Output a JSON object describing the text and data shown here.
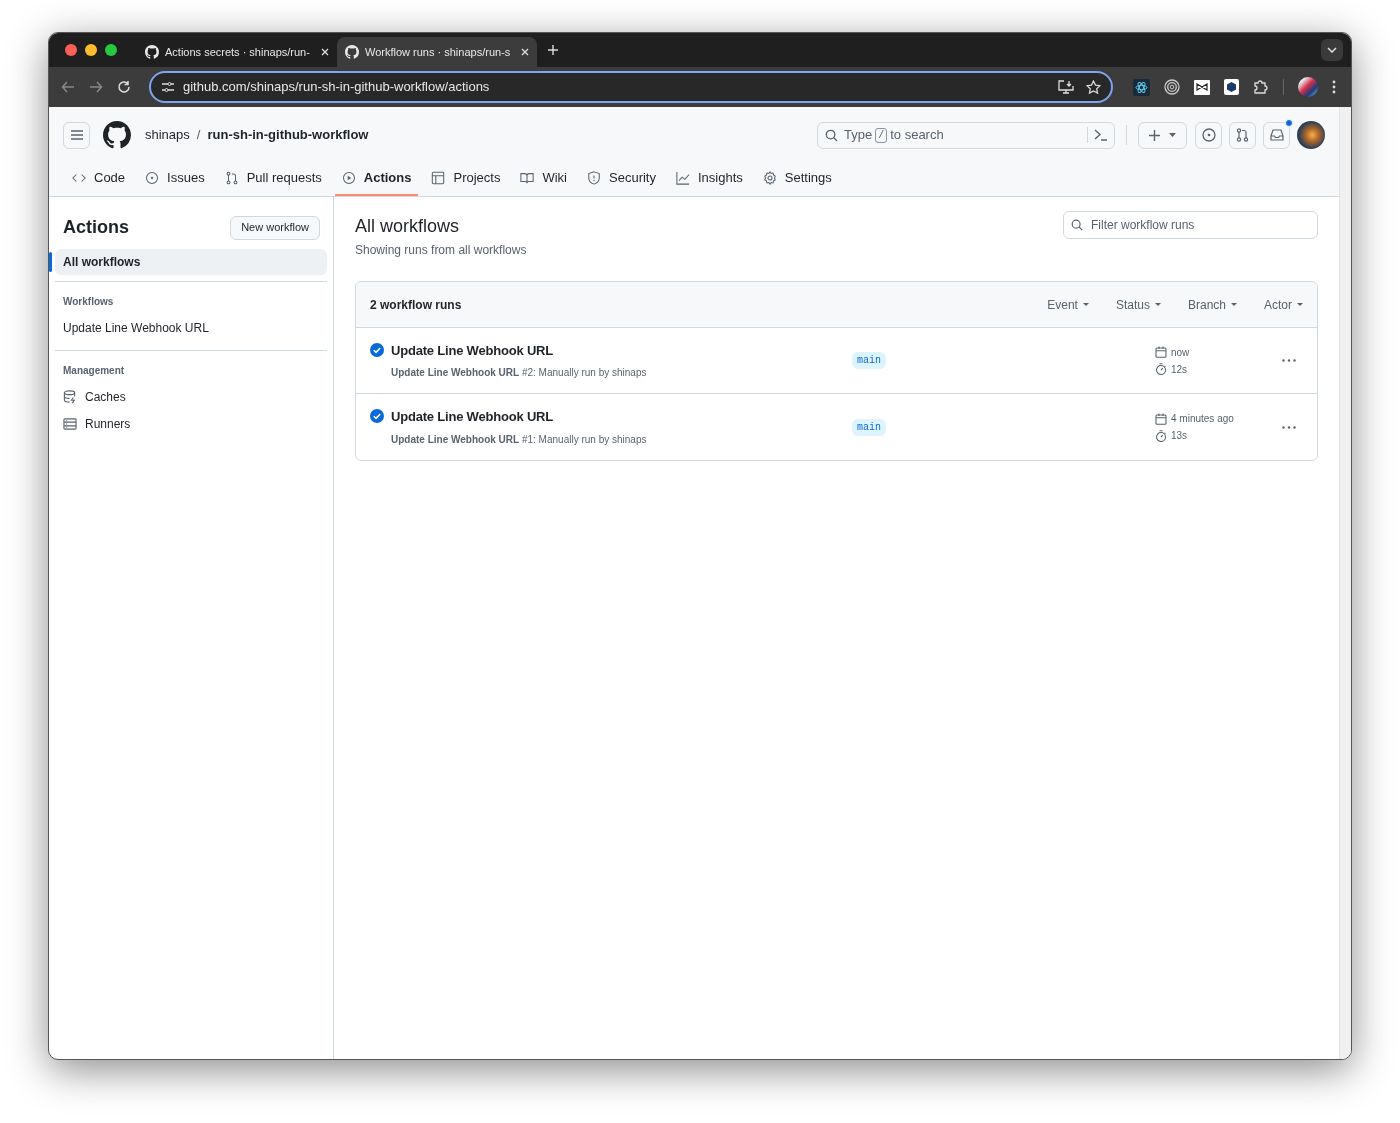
{
  "browser": {
    "tabs": [
      {
        "title": "Actions secrets · shinaps/run-",
        "selected": false
      },
      {
        "title": "Workflow runs · shinaps/run-s",
        "selected": true
      }
    ],
    "url": "github.com/shinaps/run-sh-in-github-workflow/actions"
  },
  "header": {
    "owner": "shinaps",
    "separator": "/",
    "repo": "run-sh-in-github-workflow",
    "search": {
      "placeholder": "Type",
      "shortcut_key": "/",
      "placeholder_end": "to search"
    },
    "notification_unread": true
  },
  "repo_tabs": [
    {
      "label": "Code",
      "selected": false
    },
    {
      "label": "Issues",
      "selected": false
    },
    {
      "label": "Pull requests",
      "selected": false
    },
    {
      "label": "Actions",
      "selected": true
    },
    {
      "label": "Projects",
      "selected": false
    },
    {
      "label": "Wiki",
      "selected": false
    },
    {
      "label": "Security",
      "selected": false
    },
    {
      "label": "Insights",
      "selected": false
    },
    {
      "label": "Settings",
      "selected": false
    }
  ],
  "sidebar": {
    "title": "Actions",
    "new_button": "New workflow",
    "items": [
      {
        "label": "All workflows",
        "selected": true
      }
    ],
    "sections": [
      {
        "heading": "Workflows",
        "items": [
          {
            "label": "Update Line Webhook URL",
            "kind": "text",
            "selected": false
          }
        ]
      },
      {
        "heading": "Management",
        "items": [
          {
            "label": "Caches",
            "kind": "cache",
            "selected": false
          },
          {
            "label": "Runners",
            "kind": "runner",
            "selected": false
          }
        ]
      }
    ]
  },
  "main": {
    "title": "All workflows",
    "subtitle": "Showing runs from all workflows",
    "filter": {
      "placeholder": "Filter workflow runs"
    },
    "runs_table": {
      "count": "2 workflow runs",
      "filters": [
        "Event",
        "Status",
        "Branch",
        "Actor"
      ],
      "runs": [
        {
          "title": "Update Line Webhook URL",
          "succeeded": true,
          "detail": "**Update Line Webhook URL** #2: Manually run by shinaps",
          "branch": "main",
          "when": "now",
          "duration": "12s"
        },
        {
          "title": "Update Line Webhook URL",
          "succeeded": true,
          "detail": "**Update Line Webhook URL** #1: Manually run by shinaps",
          "branch": "main",
          "when": "4 minutes ago",
          "duration": "13s"
        }
      ]
    }
  }
}
